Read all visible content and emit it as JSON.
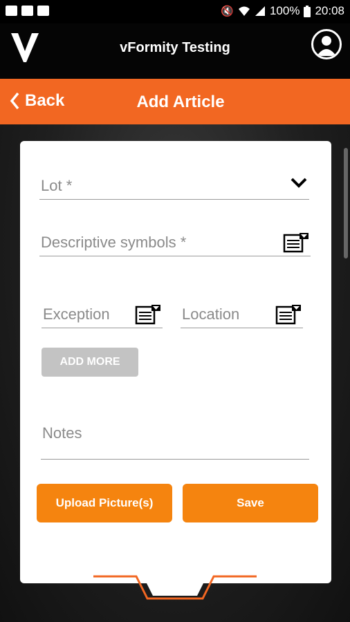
{
  "status_bar": {
    "battery": "100%",
    "time": "20:08"
  },
  "app": {
    "title": "vFormity Testing"
  },
  "nav": {
    "back_label": "Back",
    "page_title": "Add Article"
  },
  "form": {
    "lot_label": "Lot *",
    "descriptive_label": "Descriptive symbols *",
    "exception_label": "Exception",
    "location_label": "Location",
    "add_more_label": "ADD MORE",
    "notes_label": "Notes"
  },
  "actions": {
    "upload_label": "Upload Picture(s)",
    "save_label": "Save"
  },
  "colors": {
    "accent": "#f26722",
    "button": "#f5840f",
    "disabled": "#c3c3c3"
  }
}
